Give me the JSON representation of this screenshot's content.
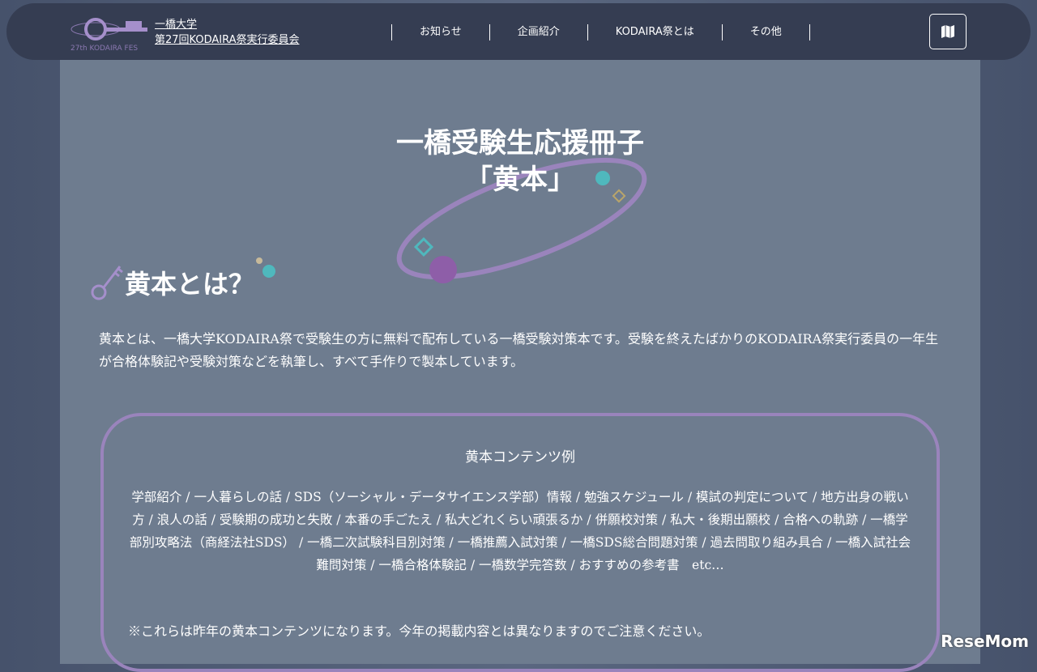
{
  "header": {
    "logo_text": "27th KODAIRA FES",
    "org_line1": "一橋大学",
    "org_line2": "第27回KODAIRA祭実行委員会",
    "nav": [
      "お知らせ",
      "企画紹介",
      "KODAIRA祭とは",
      "その他"
    ],
    "map_icon": "map-icon"
  },
  "page": {
    "title_line1": "一橋受験生応援冊子",
    "title_line2": "「黄本」"
  },
  "section": {
    "heading": "黄本とは？",
    "intro": "黄本とは、一橋大学KODAIRA祭で受験生の方に無料で配布している一橋受験対策本です。受験を終えたばかりのKODAIRA祭実行委員の一年生が合格体験記や受験対策などを執筆し、すべて手作りで製本しています。",
    "box_title": "黄本コンテンツ例",
    "box_body": "学部紹介 / 一人暮らしの話 / SDS（ソーシャル・データサイエンス学部）情報 / 勉強スケジュール / 模試の判定について / 地方出身の戦い方 / 浪人の話 / 受験期の成功と失敗 / 本番の手ごたえ / 私大どれくらい頑張るか / 併願校対策 / 私大・後期出願校 / 合格への軌跡 / 一橋学部別攻略法（商経法社SDS） / 一橋二次試験科目別対策 / 一橋推薦入試対策 / 一橋SDS総合問題対策 / 過去問取り組み具合 / 一橋入試社会難問対策 / 一橋合格体験記 / 一橋数学完答数 / おすすめの参考書　etc…",
    "note": "※これらは昨年の黄本コンテンツになります。今年の掲載内容とは異なりますのでご注意ください。"
  },
  "watermark": "ReseMom"
}
